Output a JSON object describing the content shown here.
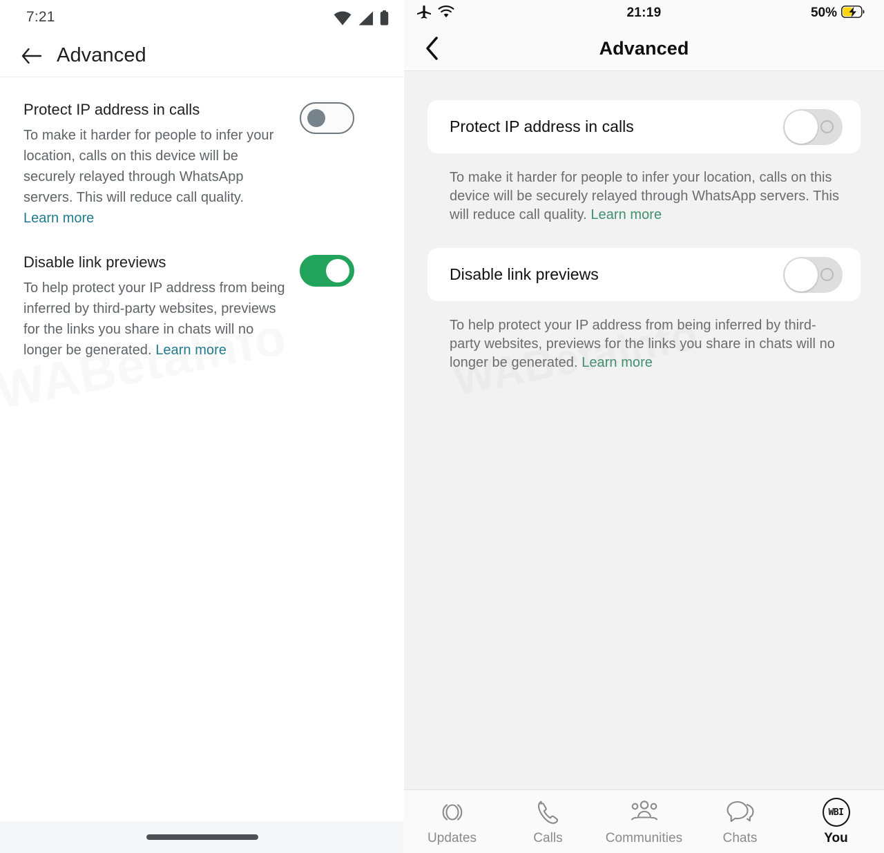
{
  "android": {
    "status_bar": {
      "clock": "7:21",
      "icons": [
        "wifi-icon",
        "cellular-signal-icon",
        "battery-icon"
      ]
    },
    "app_bar": {
      "back_icon": "arrow-left-icon",
      "title": "Advanced"
    },
    "settings": [
      {
        "title": "Protect IP address in calls",
        "description": "To make it harder for people to infer your location, calls on this device will be securely relayed through WhatsApp servers. This will reduce call quality.",
        "link": "Learn more",
        "link_inline": false,
        "toggle_state": "off"
      },
      {
        "title": "Disable link previews",
        "description": "To help protect your IP address from being inferred by third-party websites, previews for the links you share in chats will no longer be generated.",
        "link": "Learn more",
        "link_inline": true,
        "toggle_state": "on"
      }
    ],
    "nav_bar": {
      "gesture_pill": "home-gesture-pill"
    },
    "colors": {
      "link": "#1f7a8c",
      "toggle_on": "#22a35b",
      "title": "#1f1f1f",
      "body_text": "#5f6368"
    }
  },
  "ios": {
    "status_bar": {
      "airplane_icon": "airplane-mode-icon",
      "wifi_icon": "wifi-icon",
      "clock": "21:19",
      "battery_percent": "50%",
      "battery_icon": "battery-charging-icon"
    },
    "nav_bar": {
      "back_icon": "chevron-left-icon",
      "title": "Advanced"
    },
    "settings": [
      {
        "title": "Protect IP address in calls",
        "description": "To make it harder for people to infer your location, calls on this device will be securely relayed through WhatsApp servers. This will reduce call quality.",
        "link": "Learn more",
        "toggle_state": "off"
      },
      {
        "title": "Disable link previews",
        "description": "To help protect your IP address from being inferred by third-party websites, previews for the links you share in chats will no longer be generated.",
        "link": "Learn more",
        "toggle_state": "off"
      }
    ],
    "tab_bar": {
      "tabs": [
        {
          "label": "Updates",
          "icon": "status-updates-icon",
          "active": false
        },
        {
          "label": "Calls",
          "icon": "phone-icon",
          "active": false
        },
        {
          "label": "Communities",
          "icon": "communities-icon",
          "active": false
        },
        {
          "label": "Chats",
          "icon": "chat-bubbles-icon",
          "active": false
        },
        {
          "label": "You",
          "icon": "profile-avatar-icon",
          "avatar_text": "WBI",
          "active": true
        }
      ]
    },
    "colors": {
      "link": "#3f8f6e",
      "background": "#f2f2f2",
      "card": "#ffffff",
      "toggle_off_track": "#dedede"
    }
  },
  "watermark": {
    "text": "WABetaInfo"
  }
}
